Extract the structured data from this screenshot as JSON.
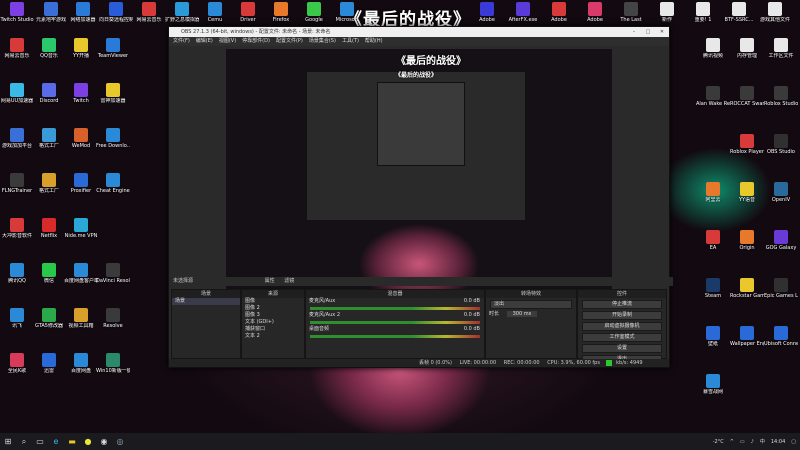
{
  "headline": "《最后的战役》",
  "desktop_icons_top": [
    {
      "label": "Twitch Studio",
      "color": "#7b3fe4"
    },
    {
      "label": "元素地牢游戏",
      "color": "#3a6fd8"
    },
    {
      "label": "网络加速器",
      "color": "#2a7ad8"
    },
    {
      "label": "向日葵远程控制",
      "color": "#2a5bd8"
    },
    {
      "label": "网易云音乐",
      "color": "#d83a3a"
    },
    {
      "label": "扩野之息模拟器",
      "color": "#2a9ad8"
    },
    {
      "label": "Cemu",
      "color": "#2a8ad8"
    },
    {
      "label": "Driver",
      "color": "#d83a3a"
    },
    {
      "label": "Firefox",
      "color": "#e8782a"
    },
    {
      "label": "Google",
      "color": "#3ac84a"
    },
    {
      "label": "Microsoft",
      "color": "#2a8ad8"
    }
  ],
  "desktop_icons_right_top": [
    {
      "label": "Adobe",
      "color": "#3a3ad8"
    },
    {
      "label": "AfterFX.exe",
      "color": "#5a3ad8"
    },
    {
      "label": "Adobe",
      "color": "#d83a3a"
    },
    {
      "label": "Adobe",
      "color": "#d83a6a"
    },
    {
      "label": "The Last",
      "color": "#444444"
    },
    {
      "label": "新作",
      "color": "#e8e8e8"
    },
    {
      "label": "重要! 1",
      "color": "#e8e8e8"
    },
    {
      "label": "BTF-SSRC...",
      "color": "#e8e8e8"
    },
    {
      "label": "游戏其他文件",
      "color": "#e8e8e8"
    }
  ],
  "desktop_icons_left": [
    {
      "label": "网易云音乐",
      "color": "#d83a3a"
    },
    {
      "label": "QQ音乐",
      "color": "#2ac86a"
    },
    {
      "label": "YY开播",
      "color": "#e8c82a"
    },
    {
      "label": "TeamViewer",
      "color": "#2a7ad8"
    },
    {
      "label": "网易UU加速器",
      "color": "#3ab8e8"
    },
    {
      "label": "Discord",
      "color": "#5a6ae8"
    },
    {
      "label": "Twitch",
      "color": "#7b3fe4"
    },
    {
      "label": "雷神加速器",
      "color": "#e8c82a"
    },
    {
      "label": "游戏加加平台",
      "color": "#3a6fd8"
    },
    {
      "label": "格式工厂",
      "color": "#3a9ad8"
    },
    {
      "label": "WeMod",
      "color": "#d8602a"
    },
    {
      "label": "Free Downlo...",
      "color": "#2a8ad8"
    },
    {
      "label": "FLNGTrainer",
      "color": "#3a3a3a"
    },
    {
      "label": "格式工厂",
      "color": "#d8a02a"
    },
    {
      "label": "Proxifier",
      "color": "#2a6ad8"
    },
    {
      "label": "Cheat Engine",
      "color": "#2a8ad8"
    },
    {
      "label": "大冲影音软件",
      "color": "#d83a3a"
    },
    {
      "label": "Netflix",
      "color": "#d82a2a"
    },
    {
      "label": "Nide.me VPN",
      "color": "#2aa8d8"
    },
    {
      "label": "腾讯QQ",
      "color": "#2a8ad8"
    },
    {
      "label": "微信",
      "color": "#2ac84a"
    },
    {
      "label": "百度网盘客户端",
      "color": "#2a8ad8"
    },
    {
      "label": "DaVinci Resol...",
      "color": "#3a3a3a"
    },
    {
      "label": "讯飞",
      "color": "#2a8ad8"
    },
    {
      "label": "GTA5修改器",
      "color": "#2aa84a"
    },
    {
      "label": "视频工具箱",
      "color": "#d8a02a"
    },
    {
      "label": "Resolve",
      "color": "#3a3a3a"
    },
    {
      "label": "全民K歌",
      "color": "#d83a5a"
    },
    {
      "label": "迅雷",
      "color": "#2a6ad8"
    },
    {
      "label": "百度网盘",
      "color": "#2a8ad8"
    },
    {
      "label": "Win10新版一键转换.exe",
      "color": "#2a8a6a"
    }
  ],
  "desktop_icons_right": [
    {
      "label": "腾讯视频",
      "color": "#e8e8e8"
    },
    {
      "label": "内存管理",
      "color": "#e8e8e8"
    },
    {
      "label": "工作区文件",
      "color": "#e8e8e8"
    },
    {
      "label": "Alan Wake Remastered",
      "color": "#3a3a3a"
    },
    {
      "label": "ROCCAT Swarm...",
      "color": "#3a3a3a"
    },
    {
      "label": "Roblox Studio",
      "color": "#3a3a3a"
    },
    {
      "label": "Roblox Player",
      "color": "#d83a3a"
    },
    {
      "label": "OBS Studio",
      "color": "#303030"
    },
    {
      "label": "阿里云",
      "color": "#e8782a"
    },
    {
      "label": "YY语音",
      "color": "#e8c82a"
    },
    {
      "label": "OpenIV",
      "color": "#2a6a9a"
    },
    {
      "label": "EA",
      "color": "#d83a3a"
    },
    {
      "label": "Origin",
      "color": "#e8782a"
    },
    {
      "label": "GOG Galaxy",
      "color": "#6a3ad8"
    },
    {
      "label": "Steam",
      "color": "#1a3a6a"
    },
    {
      "label": "Rockstar Games...",
      "color": "#e8c82a"
    },
    {
      "label": "Epic Games Launcher",
      "color": "#303030"
    },
    {
      "label": "壁纸",
      "color": "#2a6ad8"
    },
    {
      "label": "Wallpaper Engine...",
      "color": "#2a6ad8"
    },
    {
      "label": "Ubisoft Connect",
      "color": "#2a6ad8"
    },
    {
      "label": "暴雪战网",
      "color": "#2a8ad8"
    }
  ],
  "obs": {
    "title": "OBS 27.1.3 (64-bit, windows) - 配置文件: 未命名 - 场景: 未命名",
    "menu": [
      "文件(F)",
      "编辑(E)",
      "视图(V)",
      "停靠部件(D)",
      "配置文件(P)",
      "场景集合(S)",
      "工具(T)",
      "帮助(H)"
    ],
    "preview_title": "《最后的战役》",
    "nested_title": "《最后的战役》",
    "context_bar": "未选择源",
    "context_props": "属性",
    "context_filters": "滤镜",
    "docks": {
      "scenes": {
        "title": "场景",
        "items": [
          "场景"
        ]
      },
      "sources": {
        "title": "来源",
        "items": [
          "图像",
          "图像 2",
          "图像 3",
          "文本 (GDI+)",
          "捕获窗口",
          "文本 2"
        ]
      },
      "mixer": {
        "title": "混音器",
        "tracks": [
          {
            "name": "麦克风/Aux",
            "db": "0.0 dB"
          },
          {
            "name": "麦克风/Aux 2",
            "db": "0.0 dB"
          },
          {
            "name": "桌面音频",
            "db": "0.0 dB"
          }
        ]
      },
      "transitions": {
        "title": "转场特效",
        "type": "淡出",
        "duration_label": "时长",
        "duration": "300 ms"
      },
      "controls": {
        "title": "控件",
        "buttons": [
          "停止推流",
          "开始录制",
          "启动虚拟摄像机",
          "工作室模式",
          "设置",
          "退出"
        ]
      }
    },
    "status": {
      "dropped": "丢帧 0 (0.0%)",
      "live": "LIVE: 00:00:00",
      "rec": "REC: 00:00:00",
      "cpu": "CPU: 3.9%, 60.00 fps",
      "kbps": "kb/s: 4949"
    }
  },
  "taskbar": {
    "temp": "-2°C",
    "lang": "中",
    "time": "14:04"
  }
}
